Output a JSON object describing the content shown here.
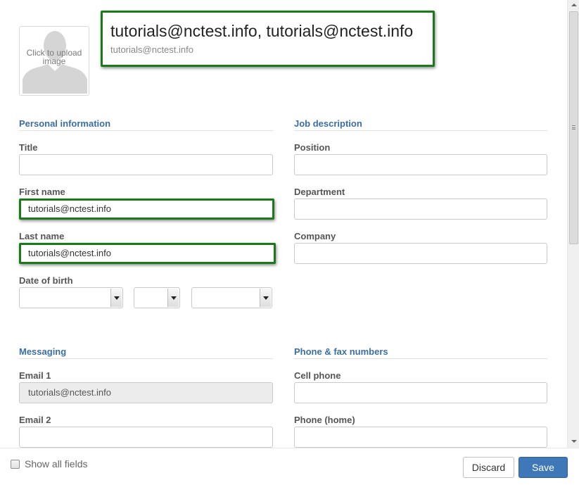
{
  "avatar": {
    "upload_text": "Click to upload image"
  },
  "header": {
    "display_name": "tutorials@nctest.info, tutorials@nctest.info",
    "email": "tutorials@nctest.info"
  },
  "personal": {
    "section_title": "Personal information",
    "title_label": "Title",
    "title_value": "",
    "first_name_label": "First name",
    "first_name_value": "tutorials@nctest.info",
    "last_name_label": "Last name",
    "last_name_value": "tutorials@nctest.info",
    "dob_label": "Date of birth",
    "dob_month": "",
    "dob_day": "",
    "dob_year": ""
  },
  "job": {
    "section_title": "Job description",
    "position_label": "Position",
    "position_value": "",
    "department_label": "Department",
    "department_value": "",
    "company_label": "Company",
    "company_value": ""
  },
  "messaging": {
    "section_title": "Messaging",
    "email1_label": "Email 1",
    "email1_value": "tutorials@nctest.info",
    "email2_label": "Email 2",
    "email2_value": ""
  },
  "phones": {
    "section_title": "Phone & fax numbers",
    "cell_label": "Cell phone",
    "cell_value": "",
    "home_label": "Phone (home)",
    "home_value": ""
  },
  "footer": {
    "show_all_label": "Show all fields",
    "show_all_checked": false,
    "discard_label": "Discard",
    "save_label": "Save"
  },
  "colors": {
    "section_title": "#3b6ea5",
    "highlight_border": "#1a7a1a",
    "primary_button": "#3e78b8"
  }
}
